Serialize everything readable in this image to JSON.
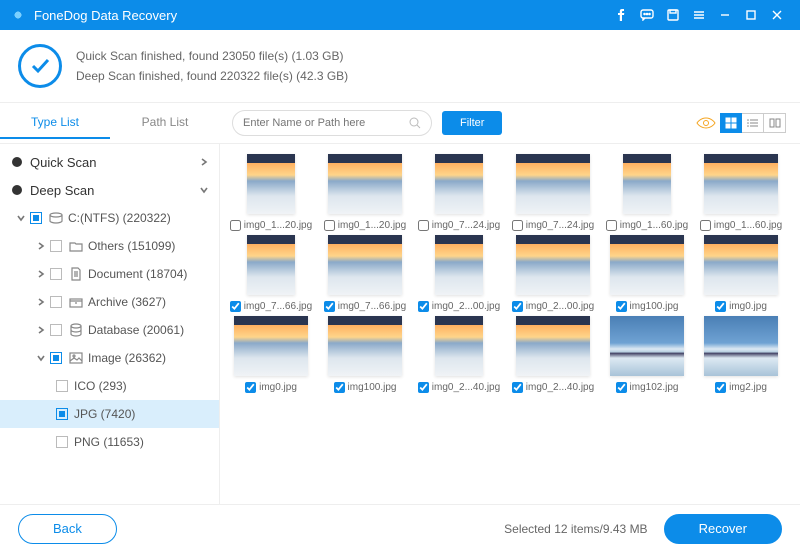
{
  "app": {
    "title": "FoneDog Data Recovery"
  },
  "status": {
    "line1": "Quick Scan finished, found 23050 file(s) (1.03 GB)",
    "line2": "Deep Scan finished, found 220322 file(s) (42.3 GB)"
  },
  "tabs": {
    "type_list": "Type List",
    "path_list": "Path List"
  },
  "search": {
    "placeholder": "Enter Name or Path here"
  },
  "filter": {
    "label": "Filter"
  },
  "tree": {
    "quick_scan": "Quick Scan",
    "deep_scan": "Deep Scan",
    "drive": "C:(NTFS) (220322)",
    "others": "Others (151099)",
    "document": "Document (18704)",
    "archive": "Archive (3627)",
    "database": "Database (20061)",
    "image": "Image (26362)",
    "ico": "ICO (293)",
    "jpg": "JPG (7420)",
    "png": "PNG (11653)"
  },
  "grid": [
    [
      {
        "name": "img0_1...20.jpg",
        "checked": false,
        "portrait": true,
        "variant": "sunset"
      },
      {
        "name": "img0_1...20.jpg",
        "checked": false,
        "portrait": false,
        "variant": "sunset"
      },
      {
        "name": "img0_7...24.jpg",
        "checked": false,
        "portrait": true,
        "variant": "sunset"
      },
      {
        "name": "img0_7...24.jpg",
        "checked": false,
        "portrait": false,
        "variant": "sunset"
      },
      {
        "name": "img0_1...60.jpg",
        "checked": false,
        "portrait": true,
        "variant": "sunset"
      },
      {
        "name": "img0_1...60.jpg",
        "checked": false,
        "portrait": false,
        "variant": "sunset"
      }
    ],
    [
      {
        "name": "img0_7...66.jpg",
        "checked": true,
        "portrait": true,
        "variant": "sunset"
      },
      {
        "name": "img0_7...66.jpg",
        "checked": true,
        "portrait": false,
        "variant": "sunset"
      },
      {
        "name": "img0_2...00.jpg",
        "checked": true,
        "portrait": true,
        "variant": "sunset"
      },
      {
        "name": "img0_2...00.jpg",
        "checked": true,
        "portrait": false,
        "variant": "sunset"
      },
      {
        "name": "img100.jpg",
        "checked": true,
        "portrait": false,
        "variant": "sunset"
      },
      {
        "name": "img0.jpg",
        "checked": true,
        "portrait": false,
        "variant": "sunset"
      }
    ],
    [
      {
        "name": "img0.jpg",
        "checked": true,
        "portrait": false,
        "variant": "sunset"
      },
      {
        "name": "img100.jpg",
        "checked": true,
        "portrait": false,
        "variant": "sunset"
      },
      {
        "name": "img0_2...40.jpg",
        "checked": true,
        "portrait": true,
        "variant": "sunset"
      },
      {
        "name": "img0_2...40.jpg",
        "checked": true,
        "portrait": false,
        "variant": "sunset"
      },
      {
        "name": "img102.jpg",
        "checked": true,
        "portrait": false,
        "variant": "island"
      },
      {
        "name": "img2.jpg",
        "checked": true,
        "portrait": false,
        "variant": "island"
      }
    ]
  ],
  "footer": {
    "back": "Back",
    "selected": "Selected 12 items/9.43 MB",
    "recover": "Recover"
  }
}
